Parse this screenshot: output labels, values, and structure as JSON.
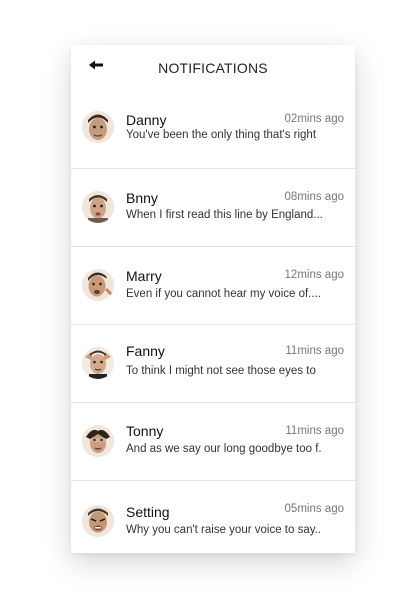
{
  "header": {
    "title": "NOTIFICATIONS",
    "back_icon": "arrow-left-icon"
  },
  "notifications": [
    {
      "name": "Danny",
      "time": "02mins ago",
      "message": "You've been the only thing that's right"
    },
    {
      "name": "Bnny",
      "time": "08mins ago",
      "message": "When I first read this line by England..."
    },
    {
      "name": "Marry",
      "time": "12mins ago",
      "message": "Even if you cannot hear my voice of...."
    },
    {
      "name": "Fanny",
      "time": "11mins ago",
      "message": "To think I might not see those eyes to"
    },
    {
      "name": "Tonny",
      "time": "11mins ago",
      "message": "And as we say our long goodbye too f."
    },
    {
      "name": "Setting",
      "time": "05mins ago",
      "message": "Why you can't raise your voice to say.."
    }
  ]
}
